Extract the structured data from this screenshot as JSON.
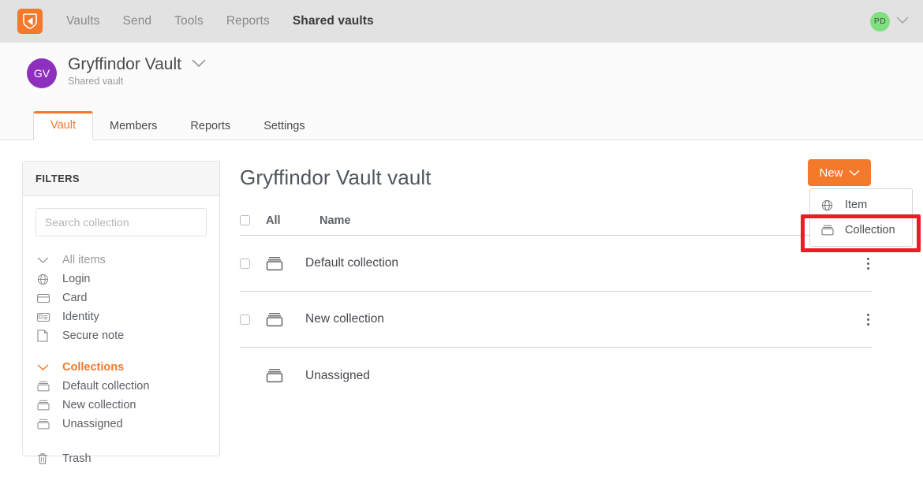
{
  "topbar": {
    "logo_icon": "bitwarden-shield-icon",
    "nav": [
      {
        "label": "Vaults",
        "active": false
      },
      {
        "label": "Send",
        "active": false
      },
      {
        "label": "Tools",
        "active": false
      },
      {
        "label": "Reports",
        "active": false
      },
      {
        "label": "Shared vaults",
        "active": true
      }
    ],
    "account_initials": "PD",
    "account_avatar_color": "#7ee07e",
    "account_chevron_icon": "chevron-down-icon"
  },
  "vault_header": {
    "avatar_initials": "GV",
    "avatar_color": "#8e2fbe",
    "title": "Gryffindor Vault",
    "title_chevron_icon": "chevron-down-icon",
    "subtitle": "Shared vault"
  },
  "tabs": [
    {
      "label": "Vault",
      "active": true
    },
    {
      "label": "Members",
      "active": false
    },
    {
      "label": "Reports",
      "active": false
    },
    {
      "label": "Settings",
      "active": false
    }
  ],
  "sidebar": {
    "heading": "FILTERS",
    "search_placeholder": "Search collection",
    "search_value": "",
    "groups": [
      {
        "header": {
          "label": "All items",
          "icon": "chevron-down-icon",
          "accent": false
        },
        "items": [
          {
            "label": "Login",
            "icon": "globe-icon"
          },
          {
            "label": "Card",
            "icon": "credit-card-icon"
          },
          {
            "label": "Identity",
            "icon": "id-card-icon"
          },
          {
            "label": "Secure note",
            "icon": "note-icon"
          }
        ]
      },
      {
        "header": {
          "label": "Collections",
          "icon": "chevron-down-icon",
          "accent": true
        },
        "items": [
          {
            "label": "Default collection",
            "icon": "collection-icon"
          },
          {
            "label": "New collection",
            "icon": "collection-icon"
          },
          {
            "label": "Unassigned",
            "icon": "collection-icon"
          }
        ]
      }
    ],
    "trash": {
      "label": "Trash",
      "icon": "trash-icon"
    }
  },
  "main": {
    "page_title": "Gryffindor Vault vault",
    "table": {
      "headers": {
        "select_all": "All",
        "name": "Name"
      },
      "rows": [
        {
          "name": "Default collection",
          "icon": "collection-icon",
          "has_checkbox": true,
          "has_menu": true
        },
        {
          "name": "New collection",
          "icon": "collection-icon",
          "has_checkbox": true,
          "has_menu": true
        },
        {
          "name": "Unassigned",
          "icon": "collection-icon",
          "has_checkbox": false,
          "has_menu": false
        }
      ]
    }
  },
  "new_menu": {
    "button_label": "New",
    "button_chevron_icon": "chevron-down-icon",
    "button_color": "#f4792b",
    "items": [
      {
        "label": "Item",
        "icon": "globe-icon"
      },
      {
        "label": "Collection",
        "icon": "collection-icon"
      }
    ],
    "highlight_color": "#ed1c24"
  }
}
